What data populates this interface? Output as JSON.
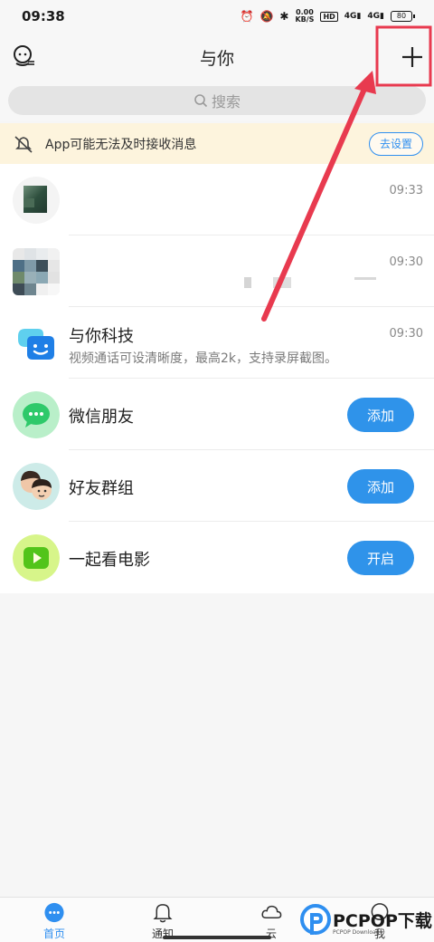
{
  "status": {
    "time": "09:38",
    "speed_value": "0.00",
    "speed_unit": "KB/S",
    "hd": "HD",
    "net1": "4G",
    "net2": "4G",
    "battery": "80"
  },
  "header": {
    "title": "与你"
  },
  "search": {
    "placeholder": "搜索"
  },
  "notice": {
    "text": "App可能无法及时接收消息",
    "button": "去设置"
  },
  "conversations": [
    {
      "time": "09:33"
    },
    {
      "time": "09:30"
    },
    {
      "title": "与你科技",
      "subtitle": "视频通话可设清晰度，最高2k，支持录屏截图。",
      "time": "09:30"
    }
  ],
  "features": [
    {
      "title": "微信朋友",
      "button": "添加"
    },
    {
      "title": "好友群组",
      "button": "添加"
    },
    {
      "title": "一起看电影",
      "button": "开启"
    }
  ],
  "tabs": [
    {
      "label": "首页",
      "active": true
    },
    {
      "label": "通知",
      "active": false
    },
    {
      "label": "云",
      "active": false
    },
    {
      "label": "我",
      "active": false
    }
  ],
  "watermark": {
    "text": "PCPOP下载",
    "sub": "PCPOP Download"
  },
  "colors": {
    "accent": "#2f8ff0",
    "button": "#2f93ea",
    "notice_bg": "#fdf4dd",
    "annotation": "#e83a4f"
  }
}
